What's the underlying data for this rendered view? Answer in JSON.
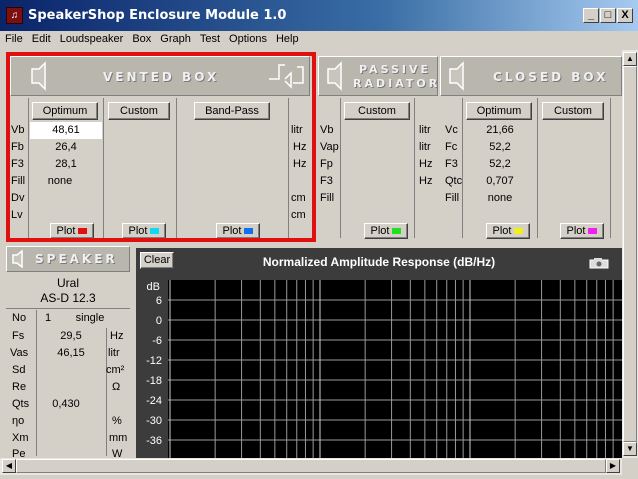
{
  "window": {
    "title": "SpeakerShop Enclosure Module 1.0",
    "min": "_",
    "max": "□",
    "close": "X"
  },
  "menu": [
    "File",
    "Edit",
    "Loudspeaker",
    "Box",
    "Graph",
    "Test",
    "Options",
    "Help"
  ],
  "vented": {
    "title": "VENTED BOX",
    "buttons": [
      "Optimum",
      "Custom",
      "Band-Pass"
    ],
    "rows": [
      {
        "label": "Vb",
        "unit": "litr",
        "values": [
          "48,61",
          "",
          ""
        ]
      },
      {
        "label": "Fb",
        "unit": "Hz",
        "values": [
          "26,4",
          "",
          ""
        ]
      },
      {
        "label": "F3",
        "unit": "Hz",
        "values": [
          "28,1",
          "",
          ""
        ]
      },
      {
        "label": "Fill",
        "unit": "",
        "values": [
          "none",
          "",
          ""
        ]
      },
      {
        "label": "Dv",
        "unit": "cm",
        "values": [
          "",
          "",
          ""
        ]
      },
      {
        "label": "Lv",
        "unit": "cm",
        "values": [
          "",
          "",
          ""
        ]
      }
    ],
    "plot": "Plot",
    "plot_colors": [
      "#e01010",
      "#10d8f0",
      "#1070f0"
    ]
  },
  "passive": {
    "title_line1": "PASSIVE",
    "title_line2": "RADIATOR",
    "button": "Custom",
    "rows": [
      {
        "label": "Vb",
        "unit": "litr"
      },
      {
        "label": "Vap",
        "unit": "litr"
      },
      {
        "label": "Fp",
        "unit": "Hz"
      },
      {
        "label": "F3",
        "unit": "Hz"
      },
      {
        "label": "Fill",
        "unit": ""
      }
    ],
    "plot": "Plot",
    "plot_color": "#20e020"
  },
  "closed": {
    "title": "CLOSED BOX",
    "buttons": [
      "Optimum",
      "Custom"
    ],
    "rows": [
      {
        "label": "Vc",
        "values": [
          "21,66",
          ""
        ]
      },
      {
        "label": "Fc",
        "values": [
          "52,2",
          ""
        ]
      },
      {
        "label": "F3",
        "values": [
          "52,2",
          ""
        ]
      },
      {
        "label": "Qtc",
        "values": [
          "0,707",
          ""
        ]
      },
      {
        "label": "Fill",
        "values": [
          "none",
          ""
        ]
      }
    ],
    "plot": "Plot",
    "plot_colors": [
      "#f0f020",
      "#f020f0"
    ]
  },
  "speaker": {
    "title": "SPEAKER",
    "brand": "Ural",
    "model": "AS-D 12.3",
    "no_label": "No",
    "no_value": "1",
    "mode": "single",
    "params": [
      {
        "label": "Fs",
        "value": "29,5",
        "unit": "Hz"
      },
      {
        "label": "Vas",
        "value": "46,15",
        "unit": "litr"
      },
      {
        "label": "Sd",
        "value": "",
        "unit": "cm²"
      },
      {
        "label": "Re",
        "value": "",
        "unit": "Ω"
      },
      {
        "label": "Qts",
        "value": "0,430",
        "unit": ""
      },
      {
        "label": "ηo",
        "value": "",
        "unit": "%"
      },
      {
        "label": "Xm",
        "value": "",
        "unit": "mm"
      },
      {
        "label": "Pe",
        "value": "",
        "unit": "W"
      }
    ]
  },
  "chart": {
    "clear": "Clear",
    "title": "Normalized Amplitude Response (dB/Hz)",
    "unit": "dB",
    "yticks": [
      "6",
      "0",
      "-6",
      "-12",
      "-18",
      "-24",
      "-30",
      "-36"
    ]
  },
  "chart_data": {
    "type": "line",
    "title": "Normalized Amplitude Response (dB/Hz)",
    "ylabel": "dB",
    "yticks": [
      6,
      0,
      -6,
      -12,
      -18,
      -24,
      -30,
      -36
    ],
    "ylim": [
      -36,
      9
    ],
    "series": [],
    "grid": true
  }
}
